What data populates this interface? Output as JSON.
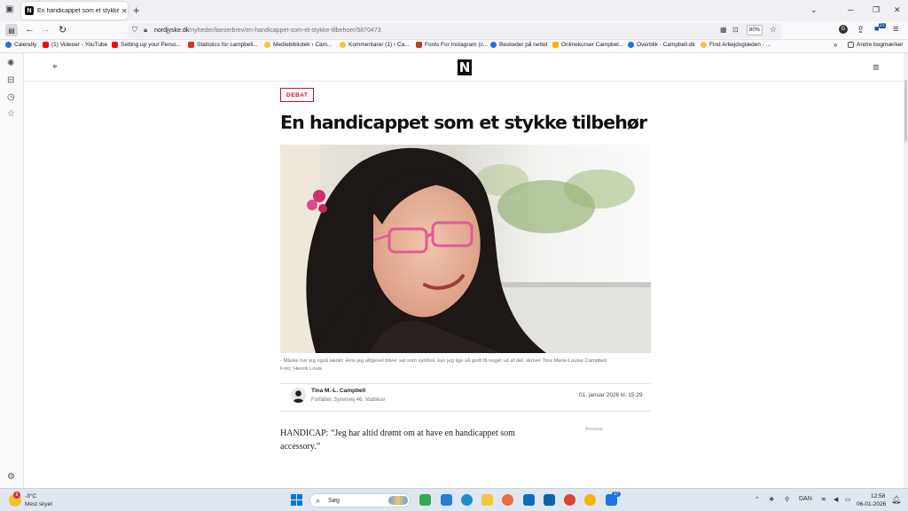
{
  "browser": {
    "tab_title": "En handicappet som et stykke t",
    "tab_favicon": "N",
    "url_host": "nordjyske.dk",
    "url_path": "/nyheder/laeserbrev/en-handicappet-som-et-stykke-tilbehoer/5870473",
    "zoom": "80%",
    "ext_badge": "21"
  },
  "bookmarks": {
    "items": [
      {
        "label": "Calendly",
        "color": "#1a73e8"
      },
      {
        "label": "(1) Videoer - YouTube",
        "color": "#ff0000"
      },
      {
        "label": "Setting up your Perso...",
        "color": "#ff0000"
      },
      {
        "label": "Statistics for campbell...",
        "color": "#d93025"
      },
      {
        "label": "Mediebibliotek ‹ Cam...",
        "color": "#f6c142"
      },
      {
        "label": "Kommentarer (1) ‹ Ca...",
        "color": "#f6c142"
      },
      {
        "label": "Fonts For Instagram (c...",
        "color": "#c0392b"
      },
      {
        "label": "Beskeder på nettet",
        "color": "#1a73e8"
      },
      {
        "label": "Onlinekurser Campbel...",
        "color": "#f4b400"
      },
      {
        "label": "Overblik - Campbell.dk",
        "color": "#1a73e8"
      },
      {
        "label": "Find Arbejdsglæden - ...",
        "color": "#f6c142"
      }
    ],
    "other": "Andre bogmærker"
  },
  "site": {
    "logo": "N"
  },
  "article": {
    "category": "DEBAT",
    "headline": "En handicappet som et stykke tilbehør",
    "caption": "- Måske har jeg også tænkt: Hvis jeg alligevel bliver set som symbol, kan jeg lige så godt få noget ud af det, skriver Tina Marie-Louise Campbell.",
    "photo_credit": "Foto: Henrik Louis",
    "author_name": "Tina M.-L. Campbell",
    "author_role": "Forfatter, Syrenvej 46, Vodskov",
    "date": "01. januar 2026 kl. 15:29",
    "lead": "HANDICAP: “Jeg har altid drømt om at have en handicappet som accessory.”",
    "ad_label": "Annonce"
  },
  "taskbar": {
    "weather_badge": "6",
    "temperature": "-3°C",
    "condition": "Mest skyet",
    "search_placeholder": "Søg",
    "language": "DAN",
    "time": "12:58",
    "date": "06-01-2026",
    "app_badge": "17"
  }
}
